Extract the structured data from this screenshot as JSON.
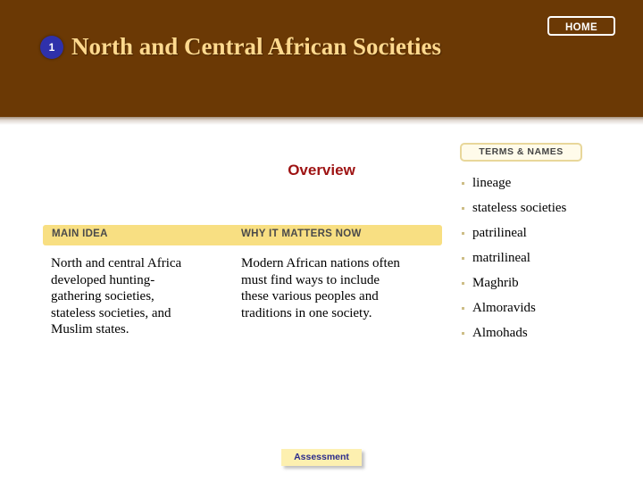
{
  "header": {
    "chapter_number": "1",
    "title": "North and Central African Societies",
    "home_label": "HOME",
    "background_color": "#6b3905",
    "title_color": "#ffd98e",
    "badge_color": "#2f31ab"
  },
  "overview": {
    "heading": "Overview",
    "heading_color": "#9e1313"
  },
  "terms": {
    "panel_title": "TERMS & NAMES",
    "items": [
      {
        "label": "lineage"
      },
      {
        "label": "stateless societies"
      },
      {
        "label": "patrilineal"
      },
      {
        "label": "matrilineal"
      },
      {
        "label": "Maghrib"
      },
      {
        "label": "Almoravids"
      },
      {
        "label": "Almohads"
      }
    ],
    "bullet_color": "#cdbd86",
    "box_fill": "#fffbea",
    "box_border": "#e8d79a"
  },
  "idea_table": {
    "bar_color": "#f8df82",
    "main_idea_header": "MAIN IDEA",
    "why_matters_header": "WHY IT MATTERS NOW",
    "main_idea_text": "North and central Africa developed hunting-gathering societies, stateless societies, and Muslim states.",
    "why_matters_text": "Modern African nations often must find ways to include these various peoples and traditions in one society."
  },
  "footer": {
    "assessment_label": "Assessment",
    "assessment_fill": "#fdf0b0",
    "assessment_text_color": "#2b2b8c"
  }
}
